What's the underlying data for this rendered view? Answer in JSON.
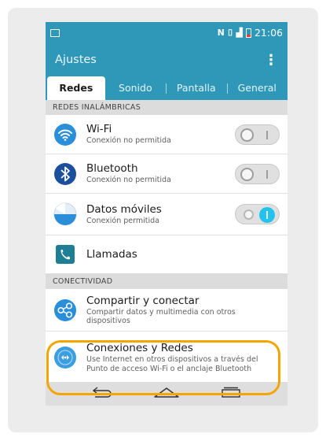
{
  "status": {
    "time": "21:06"
  },
  "appbar": {
    "title": "Ajustes",
    "menu_glyph": "⋮"
  },
  "tabs": [
    {
      "label": "Redes",
      "active": true
    },
    {
      "label": "Sonido",
      "active": false
    },
    {
      "label": "Pantalla",
      "active": false
    },
    {
      "label": "General",
      "active": false
    }
  ],
  "sections": {
    "wireless": "REDES INALÁMBRICAS",
    "connectivity": "CONECTIVIDAD"
  },
  "items": {
    "wifi": {
      "title": "Wi-Fi",
      "subtitle": "Conexión no permitida",
      "toggle": "off",
      "icon": "wifi-icon",
      "icon_color": "#2a8fd8"
    },
    "bluetooth": {
      "title": "Bluetooth",
      "subtitle": "Conexión no permitida",
      "toggle": "off",
      "icon": "bluetooth-icon",
      "icon_color": "#1c4f9c"
    },
    "mobile_data": {
      "title": "Datos móviles",
      "subtitle": "Conexión permitida",
      "toggle": "on",
      "icon": "mobile-data-icon",
      "icon_color": "#2a8fd8"
    },
    "calls": {
      "title": "Llamadas",
      "icon": "phone-icon",
      "icon_color": "#1f7e94"
    },
    "share": {
      "title": "Compartir y conectar",
      "subtitle": "Compartir datos y multimedia con otros dispositivos",
      "icon": "share-connect-icon",
      "icon_color": "#2a8fd8"
    },
    "tethering": {
      "title": "Conexiones y Redes",
      "subtitle": "Use Internet en otros dispositivos a través del Punto de acceso Wi-Fi o el anclaje Bluetooth",
      "icon": "hotspot-icon",
      "icon_color": "#3a9ee0"
    }
  },
  "colors": {
    "accent": "#2f98b8",
    "toggle_on": "#22c3ee",
    "highlight": "#f4a500"
  }
}
